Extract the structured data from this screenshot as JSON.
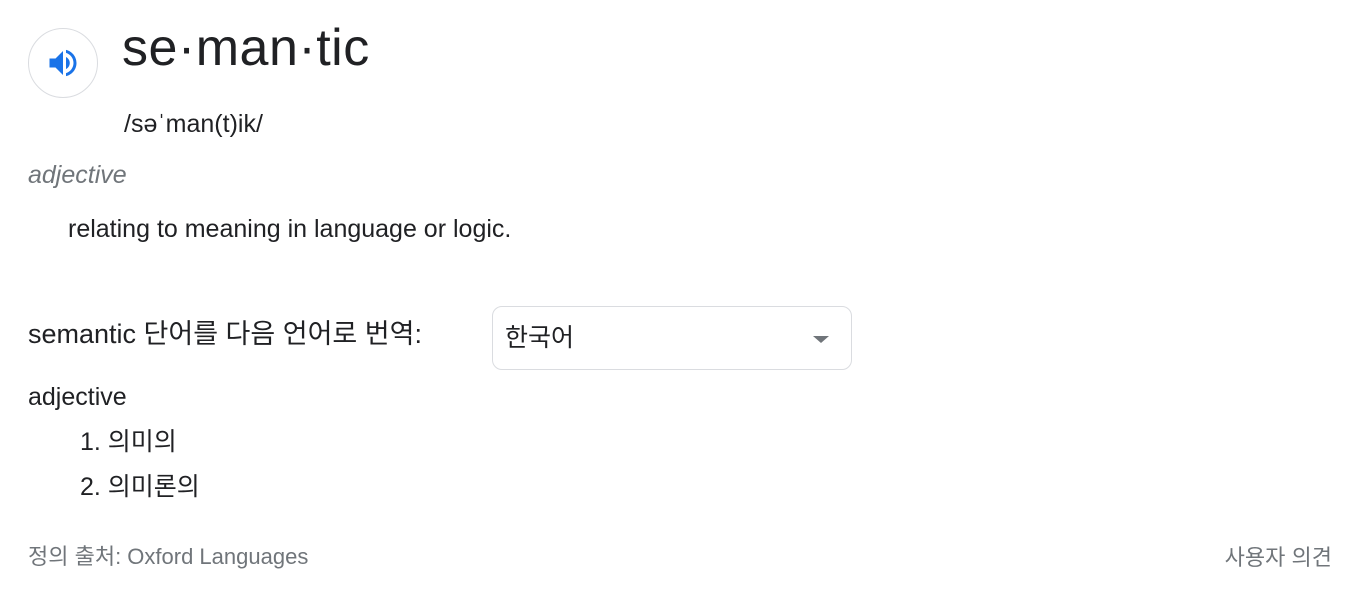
{
  "entry": {
    "headword": "se·man·tic",
    "phonetic": "/səˈman(t)ik/",
    "part_of_speech": "adjective",
    "definition": "relating to meaning in language or logic."
  },
  "audio": {
    "icon": "speaker-icon",
    "accent_color": "#1a73e8"
  },
  "translation": {
    "label": "semantic 단어를 다음 언어로 번역:",
    "selected_language": "한국어",
    "part_of_speech": "adjective",
    "items": [
      "1. 의미의",
      "2. 의미론의"
    ]
  },
  "footer": {
    "source": "정의 출처: Oxford Languages",
    "feedback": "사용자 의견"
  }
}
